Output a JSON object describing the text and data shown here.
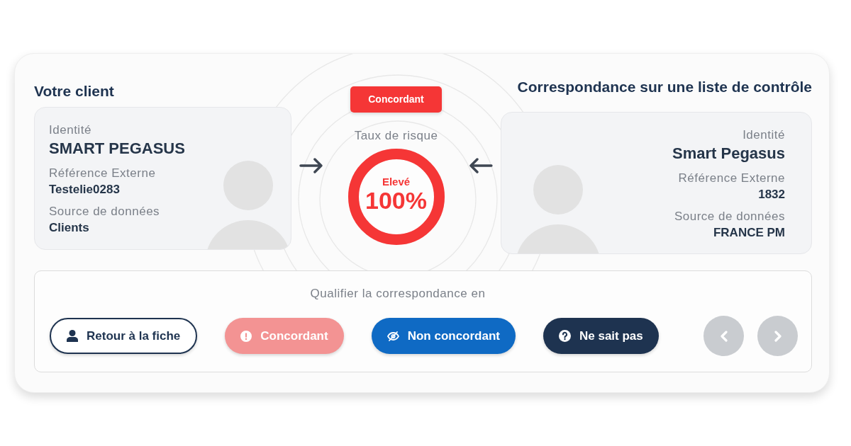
{
  "client": {
    "heading": "Votre client",
    "identity_label": "Identité",
    "identity": "SMART PEGASUS",
    "reference_label": "Référence Externe",
    "reference": "Testelie0283",
    "source_label": "Source de données",
    "source": "Clients"
  },
  "match_badge": {
    "label": "Concordant"
  },
  "risk": {
    "label": "Taux de risque",
    "rating": "Elevé",
    "value": "100%",
    "level": 1
  },
  "watchlist_match": {
    "heading": "Correspondance sur une liste de contrôle",
    "identity_label": "Identité",
    "identity": "Smart Pegasus",
    "reference_label": "Référence Externe",
    "reference": "1832",
    "source_label": "Source de données",
    "source": "FRANCE PM"
  },
  "qualification": {
    "prompt": "Qualifier la correspondance en",
    "buttons": [
      {
        "label": "Retour à la fiche",
        "kind": "back",
        "disabled": false
      },
      {
        "label": "Concordant",
        "kind": "match",
        "disabled": true
      },
      {
        "label": "Non concordant",
        "kind": "mismatch",
        "disabled": false
      },
      {
        "label": "Ne sait pas",
        "kind": "unknown",
        "disabled": false
      }
    ]
  },
  "pager": {
    "previous": {
      "disabled": true
    },
    "next": {
      "disabled": true
    }
  }
}
